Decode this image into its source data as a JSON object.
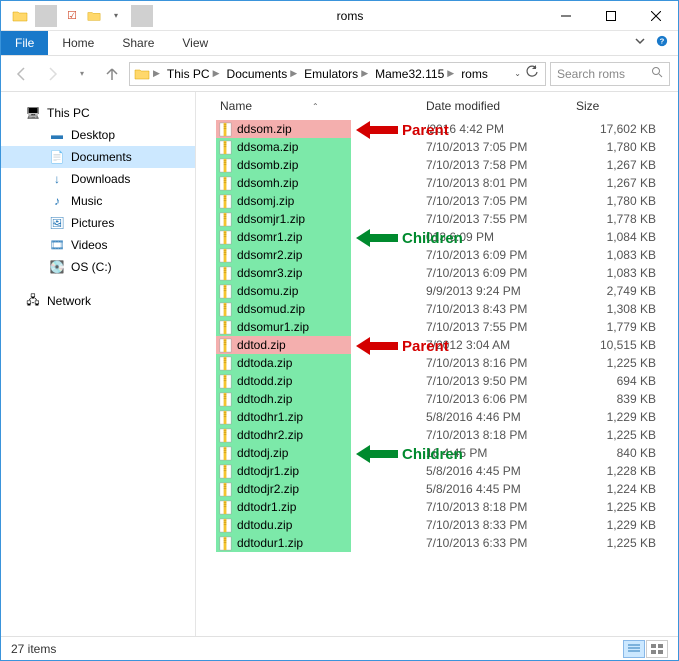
{
  "window": {
    "title": "roms"
  },
  "ribbon": {
    "file": "File",
    "home": "Home",
    "share": "Share",
    "view": "View"
  },
  "breadcrumb": [
    "This PC",
    "Documents",
    "Emulators",
    "Mame32.115",
    "roms"
  ],
  "search": {
    "placeholder": "Search roms"
  },
  "nav": {
    "thispc": "This PC",
    "desktop": "Desktop",
    "documents": "Documents",
    "downloads": "Downloads",
    "music": "Music",
    "pictures": "Pictures",
    "videos": "Videos",
    "osc": "OS (C:)",
    "network": "Network"
  },
  "columns": {
    "name": "Name",
    "date": "Date modified",
    "size": "Size"
  },
  "files": [
    {
      "name": "ddsom.zip",
      "date": "/2016 4:42 PM",
      "size": "17,602 KB",
      "kind": "parent"
    },
    {
      "name": "ddsoma.zip",
      "date": "7/10/2013 7:05 PM",
      "size": "1,780 KB",
      "kind": "child"
    },
    {
      "name": "ddsomb.zip",
      "date": "7/10/2013 7:58 PM",
      "size": "1,267 KB",
      "kind": "child"
    },
    {
      "name": "ddsomh.zip",
      "date": "7/10/2013 8:01 PM",
      "size": "1,267 KB",
      "kind": "child"
    },
    {
      "name": "ddsomj.zip",
      "date": "7/10/2013 7:05 PM",
      "size": "1,780 KB",
      "kind": "child"
    },
    {
      "name": "ddsomjr1.zip",
      "date": "7/10/2013 7:55 PM",
      "size": "1,778 KB",
      "kind": "child"
    },
    {
      "name": "ddsomr1.zip",
      "date": "013 6:09 PM",
      "size": "1,084 KB",
      "kind": "child"
    },
    {
      "name": "ddsomr2.zip",
      "date": "7/10/2013 6:09 PM",
      "size": "1,083 KB",
      "kind": "child"
    },
    {
      "name": "ddsomr3.zip",
      "date": "7/10/2013 6:09 PM",
      "size": "1,083 KB",
      "kind": "child"
    },
    {
      "name": "ddsomu.zip",
      "date": "9/9/2013 9:24 PM",
      "size": "2,749 KB",
      "kind": "child"
    },
    {
      "name": "ddsomud.zip",
      "date": "7/10/2013 8:43 PM",
      "size": "1,308 KB",
      "kind": "child"
    },
    {
      "name": "ddsomur1.zip",
      "date": "7/10/2013 7:55 PM",
      "size": "1,779 KB",
      "kind": "child"
    },
    {
      "name": "ddtod.zip",
      "date": "7/2012 3:04 AM",
      "size": "10,515 KB",
      "kind": "parent"
    },
    {
      "name": "ddtoda.zip",
      "date": "7/10/2013 8:16 PM",
      "size": "1,225 KB",
      "kind": "child"
    },
    {
      "name": "ddtodd.zip",
      "date": "7/10/2013 9:50 PM",
      "size": "694 KB",
      "kind": "child"
    },
    {
      "name": "ddtodh.zip",
      "date": "7/10/2013 6:06 PM",
      "size": "839 KB",
      "kind": "child"
    },
    {
      "name": "ddtodhr1.zip",
      "date": "5/8/2016 4:46 PM",
      "size": "1,229 KB",
      "kind": "child"
    },
    {
      "name": "ddtodhr2.zip",
      "date": "7/10/2013 8:18 PM",
      "size": "1,225 KB",
      "kind": "child"
    },
    {
      "name": "ddtodj.zip",
      "date": "16 4:45 PM",
      "size": "840 KB",
      "kind": "child"
    },
    {
      "name": "ddtodjr1.zip",
      "date": "5/8/2016 4:45 PM",
      "size": "1,228 KB",
      "kind": "child"
    },
    {
      "name": "ddtodjr2.zip",
      "date": "5/8/2016 4:45 PM",
      "size": "1,224 KB",
      "kind": "child"
    },
    {
      "name": "ddtodr1.zip",
      "date": "7/10/2013 8:18 PM",
      "size": "1,225 KB",
      "kind": "child"
    },
    {
      "name": "ddtodu.zip",
      "date": "7/10/2013 8:33 PM",
      "size": "1,229 KB",
      "kind": "child"
    },
    {
      "name": "ddtodur1.zip",
      "date": "7/10/2013 6:33 PM",
      "size": "1,225 KB",
      "kind": "child"
    }
  ],
  "annotations": {
    "parent": "Parent",
    "children": "Children"
  },
  "status": {
    "count": "27 items"
  }
}
